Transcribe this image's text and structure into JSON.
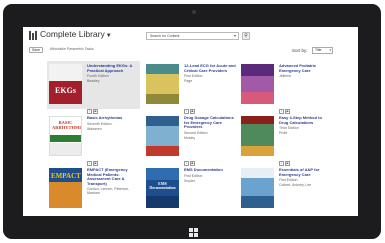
{
  "header": {
    "library_title": "Complete Library",
    "search_placeholder": "Search for Content",
    "search_button_icon": "magnifier-icon"
  },
  "filter": {
    "save_label": "Save",
    "active_filter": "Affordable Parametric Tasks",
    "sort_label": "Sort by:",
    "sort_value": "Title"
  },
  "books": [
    {
      "title": "Understanding EKGs: A Practical Approach",
      "edition": "Fourth Edition",
      "author": "Beasley",
      "cover_text": "EKGs",
      "selected": true
    },
    {
      "title": "12-Lead ECG for Acute and Critical Care Providers",
      "edition": "First Edition",
      "author": "Page",
      "cover_text": "",
      "selected": false
    },
    {
      "title": "Advanced Pediatric Emergency Care",
      "edition": "",
      "author": "Jellerne",
      "cover_text": "",
      "selected": false
    },
    {
      "title": "Basic Arrhythmias",
      "edition": "Seventh Edition",
      "author": "Walraven",
      "cover_text": "BASIC ARRHYTHMIAS",
      "selected": false
    },
    {
      "title": "Drug Dosage Calculations for Emergency Care Providers",
      "edition": "Second Edition",
      "author": "Mosley",
      "cover_text": "",
      "selected": false
    },
    {
      "title": "Easy 4-Step Method to Drug Calculations",
      "edition": "Third Edition",
      "author": "Pruitt",
      "cover_text": "",
      "selected": false
    },
    {
      "title": "EMPACT (Emergency Medical Patients: Assessment Care & Transport)",
      "edition": "",
      "author": "Gordon, Lennon, Peterson, Marriam",
      "cover_text": "EMPACT",
      "selected": false
    },
    {
      "title": "EMS Documentation",
      "edition": "First Edition",
      "author": "Snyder",
      "cover_text": "EMS Documentation",
      "selected": false
    },
    {
      "title": "Essentials of A&P for Emergency Care",
      "edition": "First Edition",
      "author": "Colbert, Ankney, Lee",
      "cover_text": "",
      "selected": false
    }
  ],
  "colors": {
    "title_link": "#2b3a8f",
    "bezel": "#1c1c1e"
  }
}
